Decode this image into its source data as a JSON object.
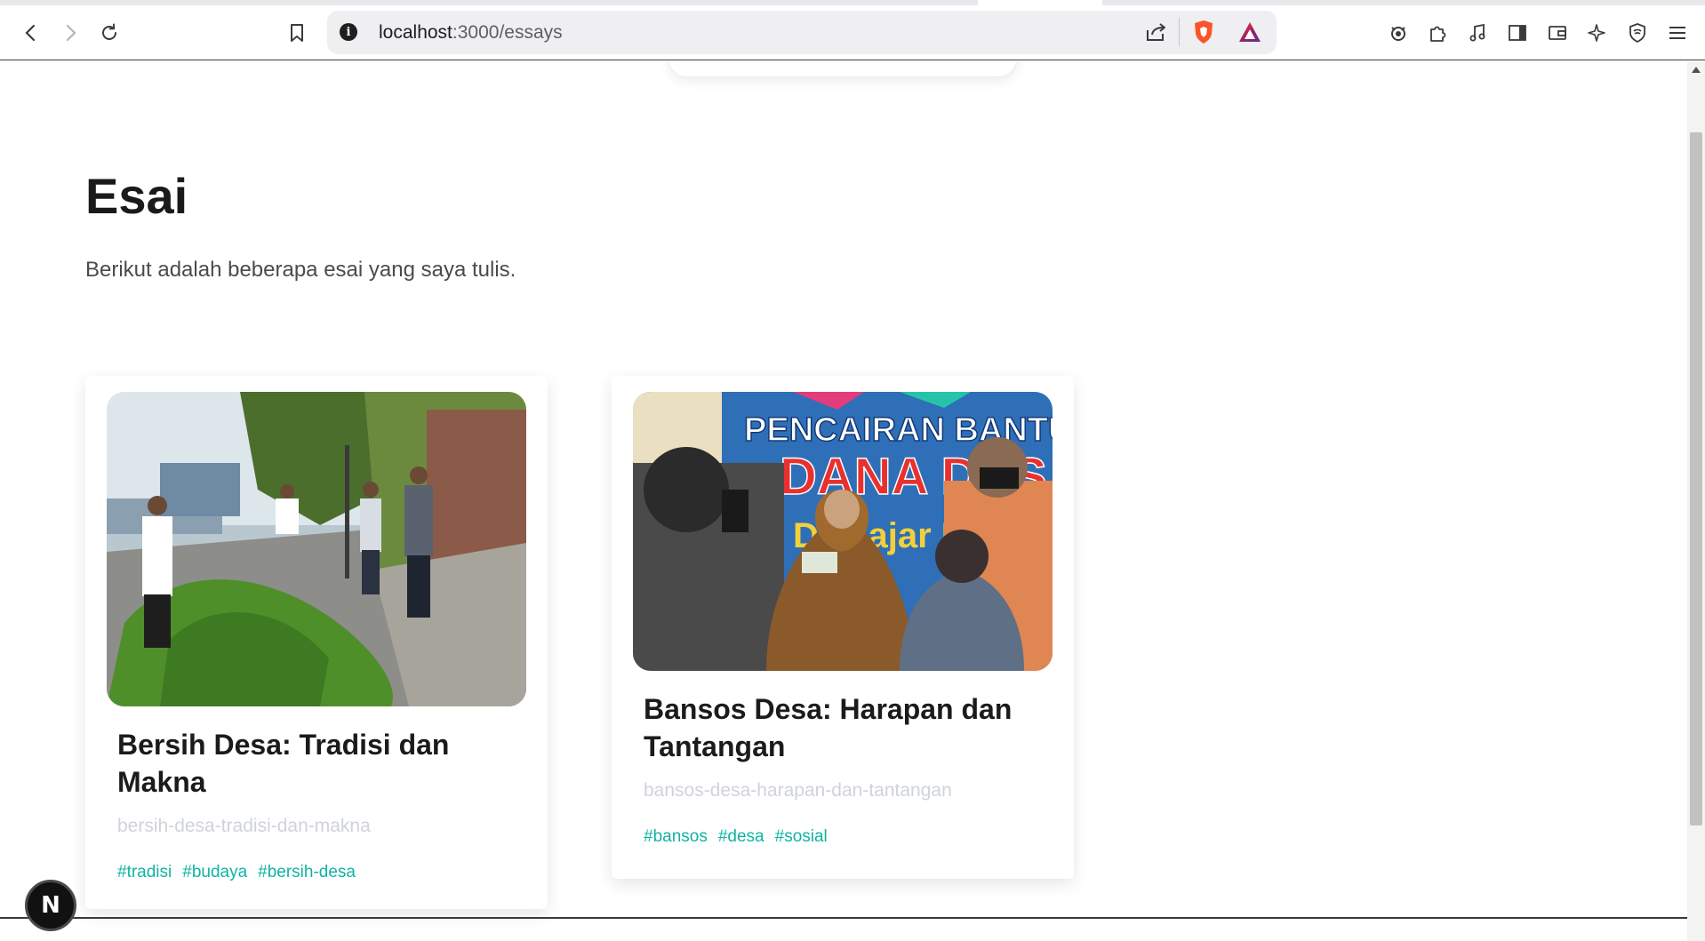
{
  "browser": {
    "url_host": "localhost",
    "url_path": ":3000/essays",
    "back_icon": "‹",
    "forward_icon": "›",
    "reload_icon": "↻",
    "bookmark_icon": "🔖",
    "info_icon": "i",
    "share_icon": "⇪",
    "extensions": [
      "🐞",
      "🧩",
      "♫",
      "◫",
      "▭",
      "✧",
      "🛡",
      "☰"
    ]
  },
  "page": {
    "title": "Esai",
    "subtitle": "Berikut adalah beberapa esai yang saya tulis."
  },
  "essays": [
    {
      "title_line1": "Bersih Desa: Tradisi dan",
      "title_line2": "Makna",
      "slug": "bersih-desa-tradisi-dan-makna",
      "tags": [
        "#tradisi",
        "#budaya",
        "#bersih-desa"
      ]
    },
    {
      "title_line1": "Bansos Desa: Harapan dan",
      "title_line2": "Tantangan",
      "slug": "bansos-desa-harapan-dan-tantangan",
      "tags": [
        "#bansos",
        "#desa",
        "#sosial"
      ],
      "banner_line1": "PENCAIRAN BANTUAN LA",
      "banner_line2": "DANA DES",
      "banner_line3": "Des    ajar Kec."
    }
  ],
  "next_badge": "N",
  "colors": {
    "tag": "#10b3a3",
    "slug": "#cfd3da",
    "heading": "#1a1a1a"
  }
}
